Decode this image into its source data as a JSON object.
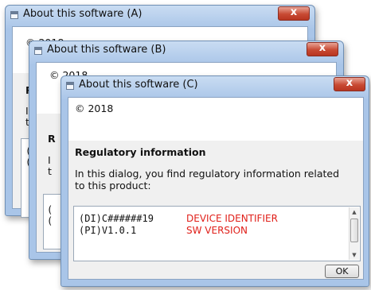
{
  "windows": {
    "a": {
      "title": "About this software (A)",
      "copyright": "© 2018",
      "reg_partial": "R",
      "text_partial_1": "Ir",
      "text_partial_2": "th",
      "box_line_1": "(U",
      "box_line_2": "(U",
      "close_glyph": "x"
    },
    "b": {
      "title": "About this software (B)",
      "copyright": "© 2018",
      "reg_partial": "R",
      "text_partial_1": "I",
      "text_partial_2": "t",
      "box_line_1": "(",
      "box_line_2": "(",
      "close_glyph": "x"
    },
    "c": {
      "title": "About this software (C)",
      "copyright": "© 2018",
      "reg_title": "Regulatory information",
      "reg_text": "In this dialog, you find regulatory information related to this product:",
      "rows": [
        {
          "code": "(DI)C######19",
          "label": "DEVICE IDENTIFIER"
        },
        {
          "code": "(PI)V1.0.1",
          "label": "SW VERSION"
        }
      ],
      "ok_label": "OK",
      "close_glyph": "x"
    }
  },
  "colors": {
    "highlight_red": "#e0201a",
    "title_blue": "#a9c5e8",
    "close_red": "#c84a33"
  },
  "icons": {
    "window": "window-icon",
    "close": "close-icon",
    "scroll_up": "scroll-up-icon",
    "scroll_down": "scroll-down-icon"
  }
}
